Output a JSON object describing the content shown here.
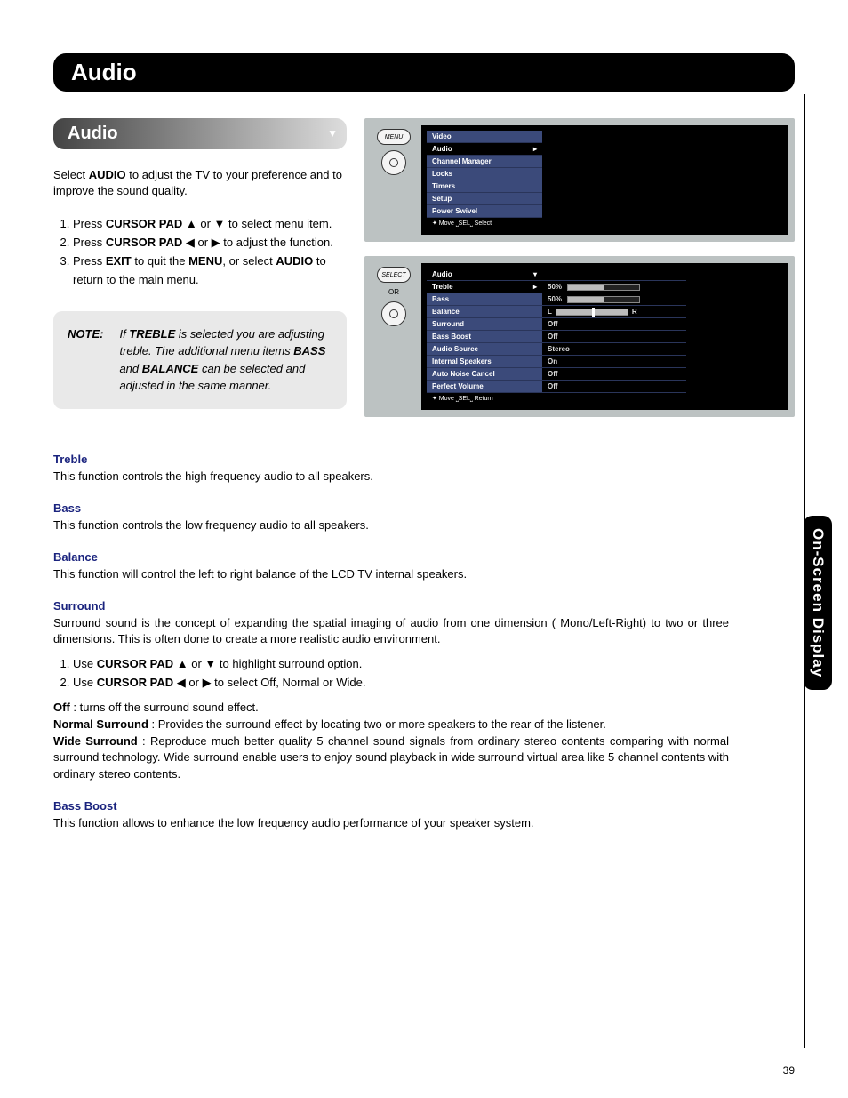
{
  "titleBar": "Audio",
  "subBar": "Audio",
  "intro": "Select AUDIO to adjust the TV to your preference and to improve the sound quality.",
  "steps": {
    "s1a": "Press ",
    "s1b": "CURSOR PAD",
    "s1c": " ▲ or ▼ to select menu item.",
    "s2a": "Press ",
    "s2b": "CURSOR PAD",
    "s2c": " ◀ or ▶ to adjust the function.",
    "s3a": "Press ",
    "s3b": "EXIT",
    "s3c": " to quit the ",
    "s3d": "MENU",
    "s3e": ", or select ",
    "s3f": "AUDIO",
    "s3g": " to return to the main menu."
  },
  "note": {
    "label": "NOTE:",
    "text": "If TREBLE is selected you are adjusting treble. The additional menu items BASS and BALANCE can be selected and adjusted in the same manner."
  },
  "remote": {
    "menu": "MENU",
    "select": "SELECT",
    "or": "OR"
  },
  "mainMenu": {
    "items": [
      "Video",
      "Audio",
      "Channel Manager",
      "Locks",
      "Timers",
      "Setup",
      "Power Swivel"
    ],
    "footer": "✦ Move  ⎵SEL⎵ Select"
  },
  "audioMenu": {
    "header": "Audio",
    "rows": [
      {
        "label": "Treble",
        "value": "50%",
        "slider": 50,
        "selected": true
      },
      {
        "label": "Bass",
        "value": "50%",
        "slider": 50
      },
      {
        "label": "Balance",
        "balance": true,
        "L": "L",
        "R": "R"
      },
      {
        "label": "Surround",
        "value": "Off"
      },
      {
        "label": "Bass Boost",
        "value": "Off"
      },
      {
        "label": "Audio Source",
        "value": "Stereo"
      },
      {
        "label": "Internal Speakers",
        "value": "On"
      },
      {
        "label": "Auto Noise Cancel",
        "value": "Off"
      },
      {
        "label": "Perfect Volume",
        "value": "Off"
      }
    ],
    "footer": "✦ Move  ⎵SEL⎵ Return"
  },
  "sections": {
    "treble": {
      "title": "Treble",
      "text": "This function controls the high frequency audio to all speakers."
    },
    "bass": {
      "title": "Bass",
      "text": "This function controls the low frequency audio to all speakers."
    },
    "balance": {
      "title": "Balance",
      "text": "This function will control the left to right balance of the LCD TV internal speakers."
    },
    "surround": {
      "title": "Surround",
      "intro": "Surround sound is the concept of expanding the spatial imaging of audio from one dimension ( Mono/Left-Right) to two or three dimensions. This is often done to create a more realistic audio environment.",
      "li1a": "Use ",
      "li1b": "CURSOR PAD",
      "li1c": " ▲ or ▼  to highlight surround option.",
      "li2a": "Use ",
      "li2b": "CURSOR PAD",
      "li2c": " ◀ or ▶  to select Off, Normal or Wide.",
      "offLabel": "Off",
      "offText": " : turns off the surround sound effect.",
      "normalLabel": "Normal Surround",
      "normalText": " :  Provides the surround effect by locating two or more speakers to the rear of the listener.",
      "wideLabel": "Wide Surround",
      "wideText": " : Reproduce much better quality 5 channel sound signals from ordinary stereo contents comparing with normal surround technology. Wide surround enable users to enjoy sound playback in wide surround virtual area like 5 channel contents with ordinary stereo contents."
    },
    "bassBoost": {
      "title": "Bass Boost",
      "text": "This function allows to enhance the low frequency audio performance of your speaker system."
    }
  },
  "sideTab": "On-Screen Display",
  "pageNum": "39"
}
